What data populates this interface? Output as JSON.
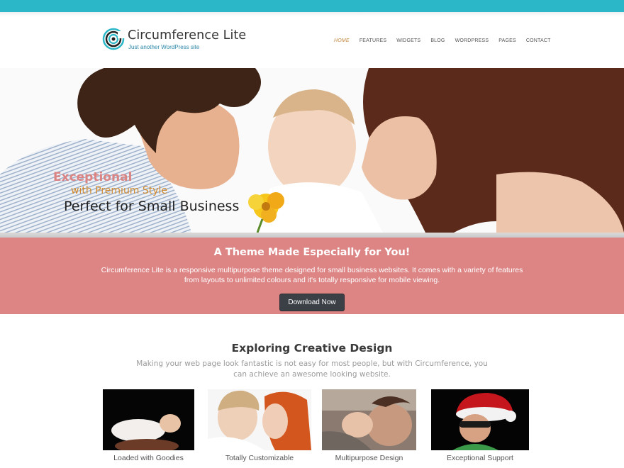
{
  "header": {
    "site_title": "Circumference Lite",
    "tagline": "Just another WordPress site",
    "brand_color": "#2cb7c8",
    "logo_icon": "concentric-circles-icon"
  },
  "nav": {
    "items": [
      {
        "label": "HOME",
        "active": true
      },
      {
        "label": "FEATURES",
        "active": false
      },
      {
        "label": "WIDGETS",
        "active": false
      },
      {
        "label": "BLOG",
        "active": false
      },
      {
        "label": "WORDPRESS",
        "active": false
      },
      {
        "label": "PAGES",
        "active": false
      },
      {
        "label": "CONTACT",
        "active": false
      }
    ],
    "active_color": "#c2883e"
  },
  "hero": {
    "line1": "Exceptional",
    "line2": "with Premium Style",
    "line3": "Perfect for Small Business",
    "image": "family-with-baby-and-yellow-flower"
  },
  "banner": {
    "title": "A Theme Made Especially for You!",
    "text": "Circumference Lite is a responsive multipurpose theme designed for small business websites. It comes with a variety of features from layouts to unlimited colours and it's totally responsive for mobile viewing.",
    "button_label": "Download Now",
    "background_color": "#dd8585"
  },
  "features_section": {
    "title": "Exploring Creative Design",
    "subtitle": "Making your web page look fantastic is not easy for most people, but with Circumference, you can achieve an awesome looking website.",
    "items": [
      {
        "label": "Loaded with Goodies",
        "image": "sleeping-baby-photo"
      },
      {
        "label": "Totally Customizable",
        "image": "mother-and-son-photo"
      },
      {
        "label": "Multipurpose Design",
        "image": "father-kissing-baby-photo"
      },
      {
        "label": "Exceptional Support",
        "image": "child-in-santa-hat-photo"
      }
    ]
  }
}
